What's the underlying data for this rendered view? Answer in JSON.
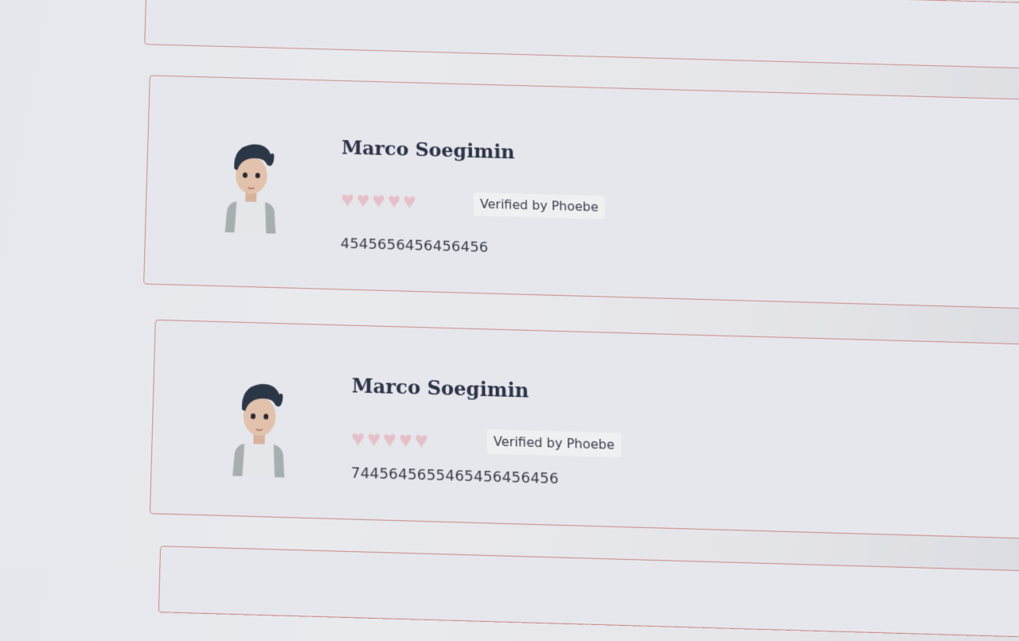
{
  "reviews": [
    {
      "name": "Marco Soegimin",
      "rating": 5,
      "hearts": [
        "♥",
        "♥",
        "♥",
        "♥",
        "♥"
      ],
      "badge": "Verified by Phoebe",
      "number": "4545656456456456",
      "avatar_icon": "boy-avatar-icon"
    },
    {
      "name": "Marco Soegimin",
      "rating": 5,
      "hearts": [
        "♥",
        "♥",
        "♥",
        "♥",
        "♥"
      ],
      "badge": "Verified by Phoebe",
      "number": "7445645655465456456456",
      "avatar_icon": "boy-avatar-icon"
    }
  ],
  "colors": {
    "card_border": "#c98a8a",
    "heart": "#e5c0c8",
    "name": "#2c3347"
  }
}
